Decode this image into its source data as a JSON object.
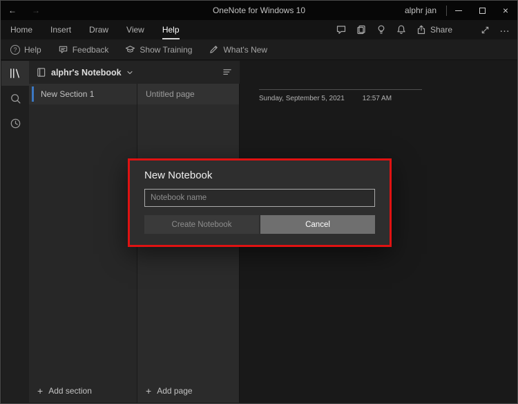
{
  "window": {
    "title": "OneNote for Windows 10",
    "user_name": "alphr jan"
  },
  "glyphs": {
    "back": "←",
    "forward": "→",
    "close": "×",
    "plus": "+",
    "question": "?",
    "more": "…"
  },
  "tabs": {
    "items": [
      {
        "label": "Home"
      },
      {
        "label": "Insert"
      },
      {
        "label": "Draw"
      },
      {
        "label": "View"
      },
      {
        "label": "Help"
      }
    ],
    "active": "Help"
  },
  "quick_actions": {
    "share_label": "Share"
  },
  "commands": {
    "items": [
      {
        "label": "Help"
      },
      {
        "label": "Feedback"
      },
      {
        "label": "Show Training"
      },
      {
        "label": "What's New"
      }
    ]
  },
  "nav": {
    "notebook_label": "alphr's Notebook",
    "sections": {
      "items": [
        {
          "label": "New Section 1"
        }
      ],
      "add_label": "Add section"
    },
    "pages": {
      "items": [
        {
          "label": "Untitled page"
        }
      ],
      "add_label": "Add page"
    }
  },
  "page": {
    "date": "Sunday, September 5, 2021",
    "time": "12:57 AM"
  },
  "dialog": {
    "title": "New Notebook",
    "input_placeholder": "Notebook name",
    "create_label": "Create Notebook",
    "cancel_label": "Cancel"
  },
  "colors": {
    "annotation_red": "#e01212",
    "section_accent": "#3b78c3",
    "titlebar_bg": "#070707",
    "dialog_bg": "#2e2e2e"
  }
}
